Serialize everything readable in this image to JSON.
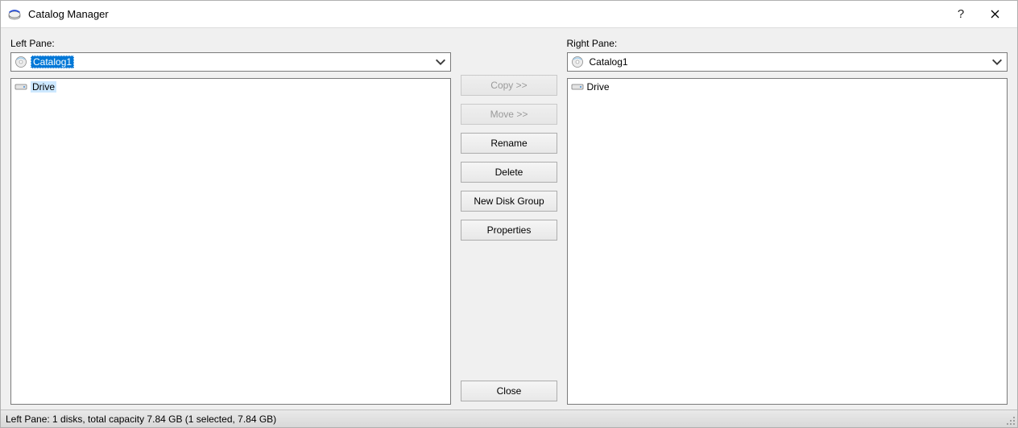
{
  "window": {
    "title": "Catalog Manager"
  },
  "left": {
    "label": "Left Pane:",
    "selected": "Catalog1",
    "items": [
      {
        "label": "Drive"
      }
    ]
  },
  "right": {
    "label": "Right Pane:",
    "selected": "Catalog1",
    "items": [
      {
        "label": "Drive"
      }
    ]
  },
  "buttons": {
    "copy": "Copy >>",
    "move": "Move >>",
    "rename": "Rename",
    "delete": "Delete",
    "new_group": "New Disk Group",
    "properties": "Properties",
    "close": "Close"
  },
  "status": "Left Pane: 1 disks, total capacity 7.84 GB (1 selected, 7.84 GB)"
}
